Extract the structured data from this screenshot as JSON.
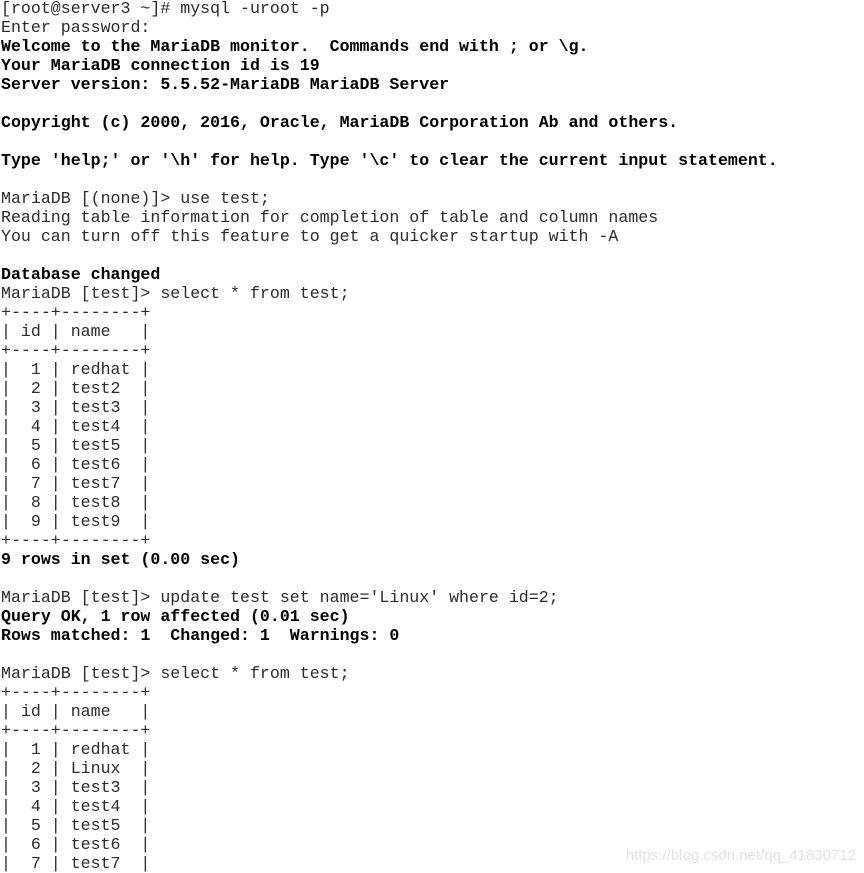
{
  "terminal": {
    "lines": [
      {
        "text": "[root@server3 ~]# mysql -uroot -p",
        "style": "normal",
        "kind": "shell-command"
      },
      {
        "text": "Enter password:",
        "style": "normal",
        "kind": "output"
      },
      {
        "text": "Welcome to the MariaDB monitor.  Commands end with ; or \\g.",
        "style": "bold",
        "kind": "output"
      },
      {
        "text": "Your MariaDB connection id is 19",
        "style": "bold",
        "kind": "output"
      },
      {
        "text": "Server version: 5.5.52-MariaDB MariaDB Server",
        "style": "bold",
        "kind": "output"
      },
      {
        "text": "",
        "style": "normal",
        "kind": "blank"
      },
      {
        "text": "Copyright (c) 2000, 2016, Oracle, MariaDB Corporation Ab and others.",
        "style": "bold",
        "kind": "output"
      },
      {
        "text": "",
        "style": "normal",
        "kind": "blank"
      },
      {
        "text": "Type 'help;' or '\\h' for help. Type '\\c' to clear the current input statement.",
        "style": "bold",
        "kind": "output"
      },
      {
        "text": "",
        "style": "normal",
        "kind": "blank"
      },
      {
        "text": "MariaDB [(none)]> use test;",
        "style": "normal",
        "kind": "sql-command"
      },
      {
        "text": "Reading table information for completion of table and column names",
        "style": "normal",
        "kind": "output"
      },
      {
        "text": "You can turn off this feature to get a quicker startup with -A",
        "style": "normal",
        "kind": "output"
      },
      {
        "text": "",
        "style": "normal",
        "kind": "blank"
      },
      {
        "text": "Database changed",
        "style": "bold",
        "kind": "output"
      },
      {
        "text": "MariaDB [test]> select * from test;",
        "style": "normal",
        "kind": "sql-command"
      },
      {
        "text": "+----+--------+",
        "style": "normal",
        "kind": "table-border"
      },
      {
        "text": "| id | name   |",
        "style": "normal",
        "kind": "table-header"
      },
      {
        "text": "+----+--------+",
        "style": "normal",
        "kind": "table-border"
      },
      {
        "text": "|  1 | redhat |",
        "style": "normal",
        "kind": "table-row"
      },
      {
        "text": "|  2 | test2  |",
        "style": "normal",
        "kind": "table-row"
      },
      {
        "text": "|  3 | test3  |",
        "style": "normal",
        "kind": "table-row"
      },
      {
        "text": "|  4 | test4  |",
        "style": "normal",
        "kind": "table-row"
      },
      {
        "text": "|  5 | test5  |",
        "style": "normal",
        "kind": "table-row"
      },
      {
        "text": "|  6 | test6  |",
        "style": "normal",
        "kind": "table-row"
      },
      {
        "text": "|  7 | test7  |",
        "style": "normal",
        "kind": "table-row"
      },
      {
        "text": "|  8 | test8  |",
        "style": "normal",
        "kind": "table-row"
      },
      {
        "text": "|  9 | test9  |",
        "style": "normal",
        "kind": "table-row"
      },
      {
        "text": "+----+--------+",
        "style": "normal",
        "kind": "table-border"
      },
      {
        "text": "9 rows in set (0.00 sec)",
        "style": "bold",
        "kind": "output"
      },
      {
        "text": "",
        "style": "normal",
        "kind": "blank"
      },
      {
        "text": "MariaDB [test]> update test set name='Linux' where id=2;",
        "style": "normal",
        "kind": "sql-command"
      },
      {
        "text": "Query OK, 1 row affected (0.01 sec)",
        "style": "bold",
        "kind": "output"
      },
      {
        "text": "Rows matched: 1  Changed: 1  Warnings: 0",
        "style": "bold",
        "kind": "output"
      },
      {
        "text": "",
        "style": "normal",
        "kind": "blank"
      },
      {
        "text": "MariaDB [test]> select * from test;",
        "style": "normal",
        "kind": "sql-command"
      },
      {
        "text": "+----+--------+",
        "style": "normal",
        "kind": "table-border"
      },
      {
        "text": "| id | name   |",
        "style": "normal",
        "kind": "table-header"
      },
      {
        "text": "+----+--------+",
        "style": "normal",
        "kind": "table-border"
      },
      {
        "text": "|  1 | redhat |",
        "style": "normal",
        "kind": "table-row"
      },
      {
        "text": "|  2 | Linux  |",
        "style": "normal",
        "kind": "table-row"
      },
      {
        "text": "|  3 | test3  |",
        "style": "normal",
        "kind": "table-row"
      },
      {
        "text": "|  4 | test4  |",
        "style": "normal",
        "kind": "table-row"
      },
      {
        "text": "|  5 | test5  |",
        "style": "normal",
        "kind": "table-row"
      },
      {
        "text": "|  6 | test6  |",
        "style": "normal",
        "kind": "table-row"
      },
      {
        "text": "|  7 | test7  |",
        "style": "normal",
        "kind": "table-row"
      }
    ]
  },
  "watermark": {
    "text": "https://blog.csdn.net/qq_41830712"
  },
  "colors": {
    "background": "#ffffff",
    "text_normal": "#2b2b2b",
    "text_bold": "#000000",
    "watermark": "#e2e2e2"
  }
}
